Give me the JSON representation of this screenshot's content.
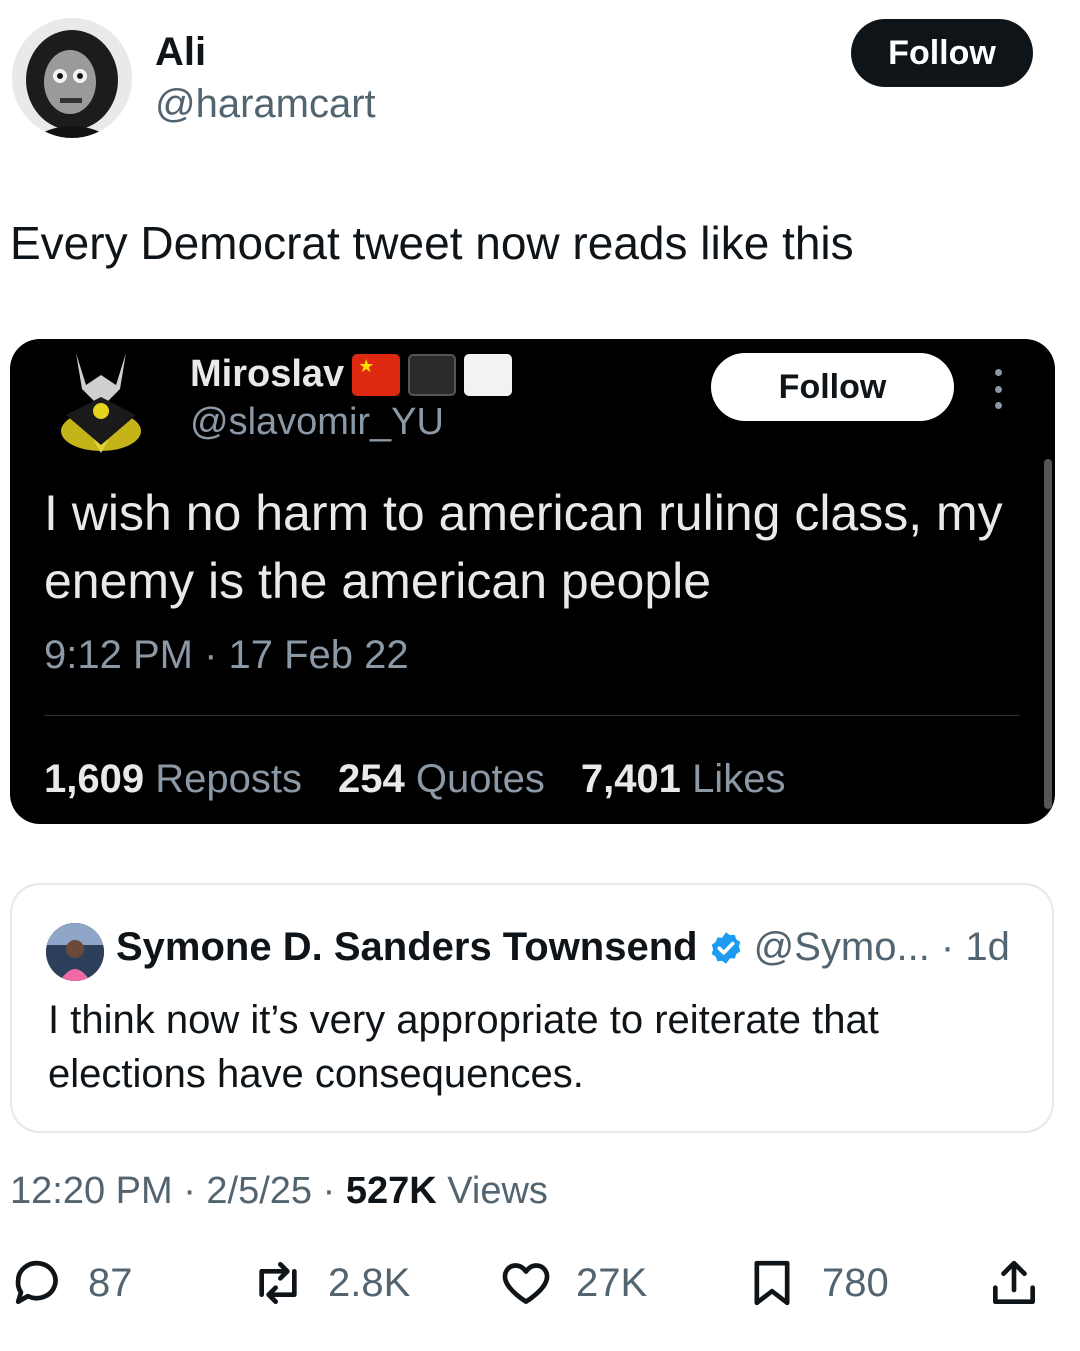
{
  "author": {
    "name": "Ali",
    "handle": "@haramcart",
    "follow_label": "Follow"
  },
  "tweet_text": "Every Democrat tweet now reads like this",
  "embedded_tweet": {
    "name": "Miroslav",
    "flags": [
      "china-flag",
      "black-square",
      "white-square"
    ],
    "handle": "@slavomir_YU",
    "follow_label": "Follow",
    "text": "I wish no harm to american ruling class, my enemy is the american people",
    "timestamp": "9:12 PM · 17 Feb 22",
    "stats": {
      "reposts_count": "1,609",
      "reposts_label": "Reposts",
      "quotes_count": "254",
      "quotes_label": "Quotes",
      "likes_count": "7,401",
      "likes_label": "Likes"
    }
  },
  "quoted_tweet": {
    "name": "Symone D. Sanders Townsend",
    "verified": true,
    "handle_time": "@Symo... · 1d",
    "text": "I think now it’s very appropriate to reiterate that elections have consequences."
  },
  "meta": {
    "time_date": "12:20 PM · 2/5/25 · ",
    "views_count": "527K",
    "views_label": " Views"
  },
  "actions": {
    "replies": "87",
    "reposts": "2.8K",
    "likes": "27K",
    "bookmarks": "780"
  },
  "colors": {
    "text_primary": "#0f1419",
    "text_secondary": "#536471",
    "verified_blue": "#1d9bf0",
    "dark_bg": "#000000"
  }
}
